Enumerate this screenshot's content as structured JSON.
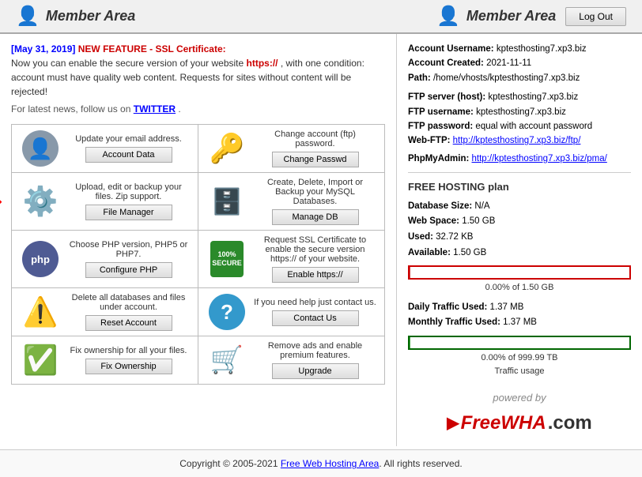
{
  "header": {
    "logo_text": "Member Area",
    "logo_text_right": "Member Area",
    "logout_label": "Log Out"
  },
  "announcement": {
    "date": "[May 31, 2019]",
    "feature_label": " NEW FEATURE - SSL Certificate:",
    "line1": "Now you can enable the secure version of your website",
    "https_text": "https://",
    "line2": ", with one condition: account must have quality web content. Requests for sites without content will be rejected!",
    "twitter_prefix": "For latest news, follow us on ",
    "twitter_word": "TWITTER",
    "twitter_suffix": "."
  },
  "menu": {
    "rows": [
      {
        "left": {
          "icon": "user",
          "desc": "Update your email address.",
          "btn": "Account Data"
        },
        "right": {
          "icon": "key",
          "desc": "Change account (ftp) password.",
          "btn": "Change Passwd"
        }
      },
      {
        "left": {
          "icon": "gear-folder",
          "desc": "Upload, edit or backup your files. Zip support.",
          "btn": "File Manager"
        },
        "right": {
          "icon": "db",
          "desc": "Create, Delete, Import or Backup your MySQL Databases.",
          "btn": "Manage DB"
        }
      },
      {
        "left": {
          "icon": "php",
          "desc": "Choose PHP version, PHP5 or PHP7.",
          "btn": "Configure PHP"
        },
        "right": {
          "icon": "secure",
          "desc": "Request SSL Certificate to enable the secure version https:// of your website.",
          "btn": "Enable https://"
        }
      },
      {
        "left": {
          "icon": "warning",
          "desc": "Delete all databases and files under account.",
          "btn": "Reset Account"
        },
        "right": {
          "icon": "question",
          "desc": "If you need help just contact us.",
          "btn": "Contact Us"
        }
      },
      {
        "left": {
          "icon": "checkmark",
          "desc": "Fix ownership for all your files.",
          "btn": "Fix Ownership"
        },
        "right": {
          "icon": "cart",
          "desc": "Remove ads and enable premium features.",
          "btn": "Upgrade"
        }
      }
    ]
  },
  "account": {
    "username_label": "Account Username:",
    "username_val": "kptesthosting7.xp3.biz",
    "created_label": "Account Created:",
    "created_val": "2021-11-11",
    "path_label": "Path:",
    "path_val": "/home/vhosts/kptesthosting7.xp3.biz",
    "ftp_server_label": "FTP server (host):",
    "ftp_server_val": "kptesthosting7.xp3.biz",
    "ftp_user_label": "FTP username:",
    "ftp_user_val": "kptesthosting7.xp3.biz",
    "ftp_pass_label": "FTP password:",
    "ftp_pass_val": "equal with account password",
    "webftp_label": "Web-FTP:",
    "webftp_url": "http://kptesthosting7.xp3.biz/ftp/",
    "phpmyadmin_label": "PhpMyAdmin:",
    "phpmyadmin_url": "http://kptesthosting7.xp3.biz/pma/"
  },
  "plan": {
    "title": "FREE HOSTING plan",
    "db_label": "Database Size:",
    "db_val": "N/A",
    "webspace_label": "Web Space:",
    "webspace_val": "1.50 GB",
    "used_label": "Used:",
    "used_val": "32.72 KB",
    "available_label": "Available:",
    "available_val": "1.50 GB",
    "progress_text": "0.00% of 1.50 GB",
    "daily_traffic_label": "Daily Traffic Used:",
    "daily_traffic_val": "1.37 MB",
    "monthly_traffic_label": "Monthly Traffic Used:",
    "monthly_traffic_val": "1.37 MB",
    "traffic_progress_text": "0.00% of 999.99 TB",
    "traffic_sub": "Traffic usage"
  },
  "powered": {
    "by_text": "powered by",
    "brand": "FreeWHA",
    "dot_com": ".com"
  },
  "footer": {
    "copy": "Copyright © 2005-2021 ",
    "link_text": "Free Web Hosting Area",
    "suffix": ". All rights reserved."
  }
}
